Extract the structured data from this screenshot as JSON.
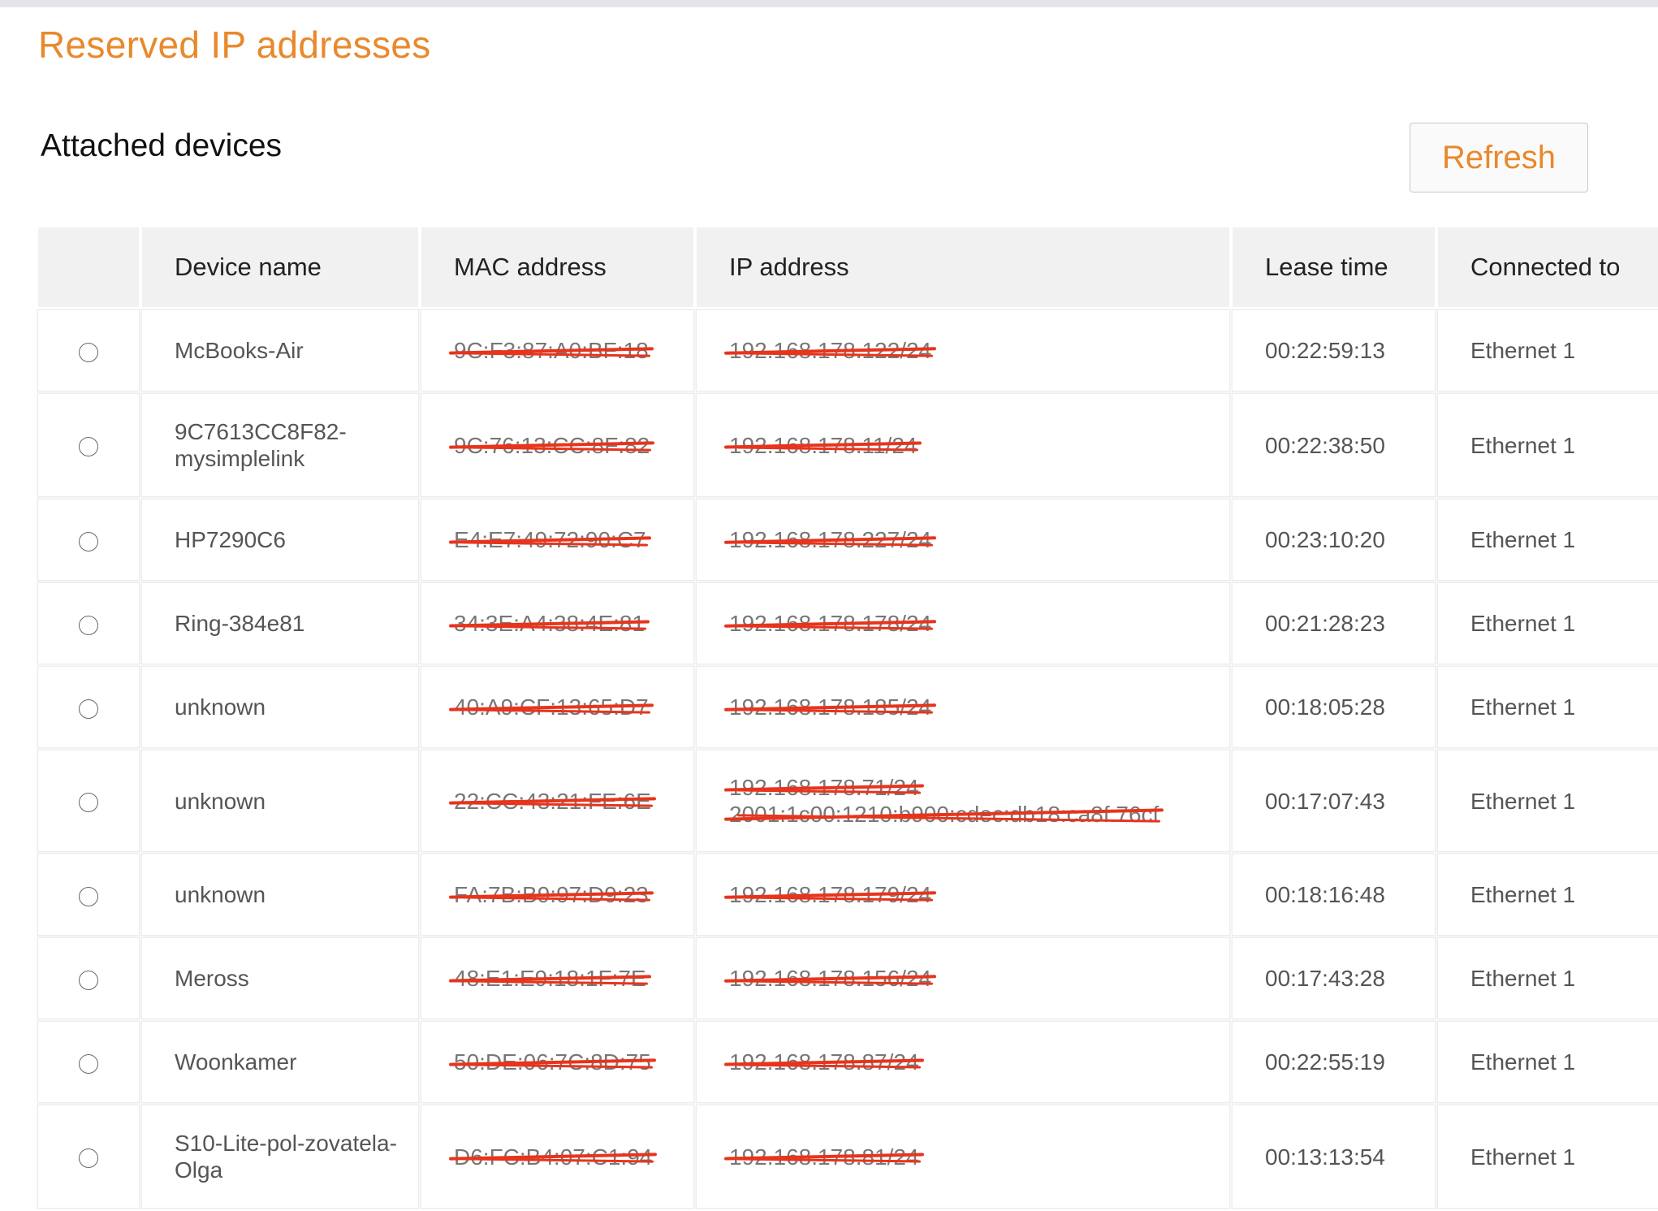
{
  "page": {
    "title": "Reserved IP addresses",
    "section_title": "Attached devices",
    "refresh_label": "Refresh",
    "accent_color": "#e8892c",
    "redaction_color": "#e8341c"
  },
  "table": {
    "headers": [
      "",
      "Device name",
      "MAC address",
      "IP address",
      "Lease time",
      "Connected to"
    ],
    "rows": [
      {
        "name": "McBooks-Air",
        "mac": "9C:F3:87:A0:BF:18",
        "ip": "192.168.178.122/24",
        "ip2": "",
        "lease": "00:22:59:13",
        "connected": "Ethernet 1"
      },
      {
        "name": "9C7613CC8F82-mysimplelink",
        "mac": "9C:76:13:CC:8F:82",
        "ip": "192.168.178.11/24",
        "ip2": "",
        "lease": "00:22:38:50",
        "connected": "Ethernet 1"
      },
      {
        "name": "HP7290C6",
        "mac": "E4:E7:49:72:90:C7",
        "ip": "192.168.178.227/24",
        "ip2": "",
        "lease": "00:23:10:20",
        "connected": "Ethernet 1"
      },
      {
        "name": "Ring-384e81",
        "mac": "34:3E:A4:38:4E:81",
        "ip": "192.168.178.178/24",
        "ip2": "",
        "lease": "00:21:28:23",
        "connected": "Ethernet 1"
      },
      {
        "name": "unknown",
        "mac": "40:A9:CF:13:65:D7",
        "ip": "192.168.178.185/24",
        "ip2": "",
        "lease": "00:18:05:28",
        "connected": "Ethernet 1"
      },
      {
        "name": "unknown",
        "mac": "22:CC:43:21:FE:6E",
        "ip": "192.168.178.71/24",
        "ip2": "2001:1c00:1210:b900:cdec:db18:ca8f:76cf",
        "lease": "00:17:07:43",
        "connected": "Ethernet 1"
      },
      {
        "name": "unknown",
        "mac": "FA:7B:B9:97:D9:23",
        "ip": "192.168.178.179/24",
        "ip2": "",
        "lease": "00:18:16:48",
        "connected": "Ethernet 1"
      },
      {
        "name": "Meross",
        "mac": "48:E1:E9:18:1F:7E",
        "ip": "192.168.178.156/24",
        "ip2": "",
        "lease": "00:17:43:28",
        "connected": "Ethernet 1"
      },
      {
        "name": "Woonkamer",
        "mac": "50:DE:06:7C:8D:75",
        "ip": "192.168.178.87/24",
        "ip2": "",
        "lease": "00:22:55:19",
        "connected": "Ethernet 1"
      },
      {
        "name": "S10-Lite-pol-zovatela-Olga",
        "mac": "D6:FC:B4:07:C1:94",
        "ip": "192.168.178.81/24",
        "ip2": "",
        "lease": "00:13:13:54",
        "connected": "Ethernet 1"
      }
    ]
  }
}
